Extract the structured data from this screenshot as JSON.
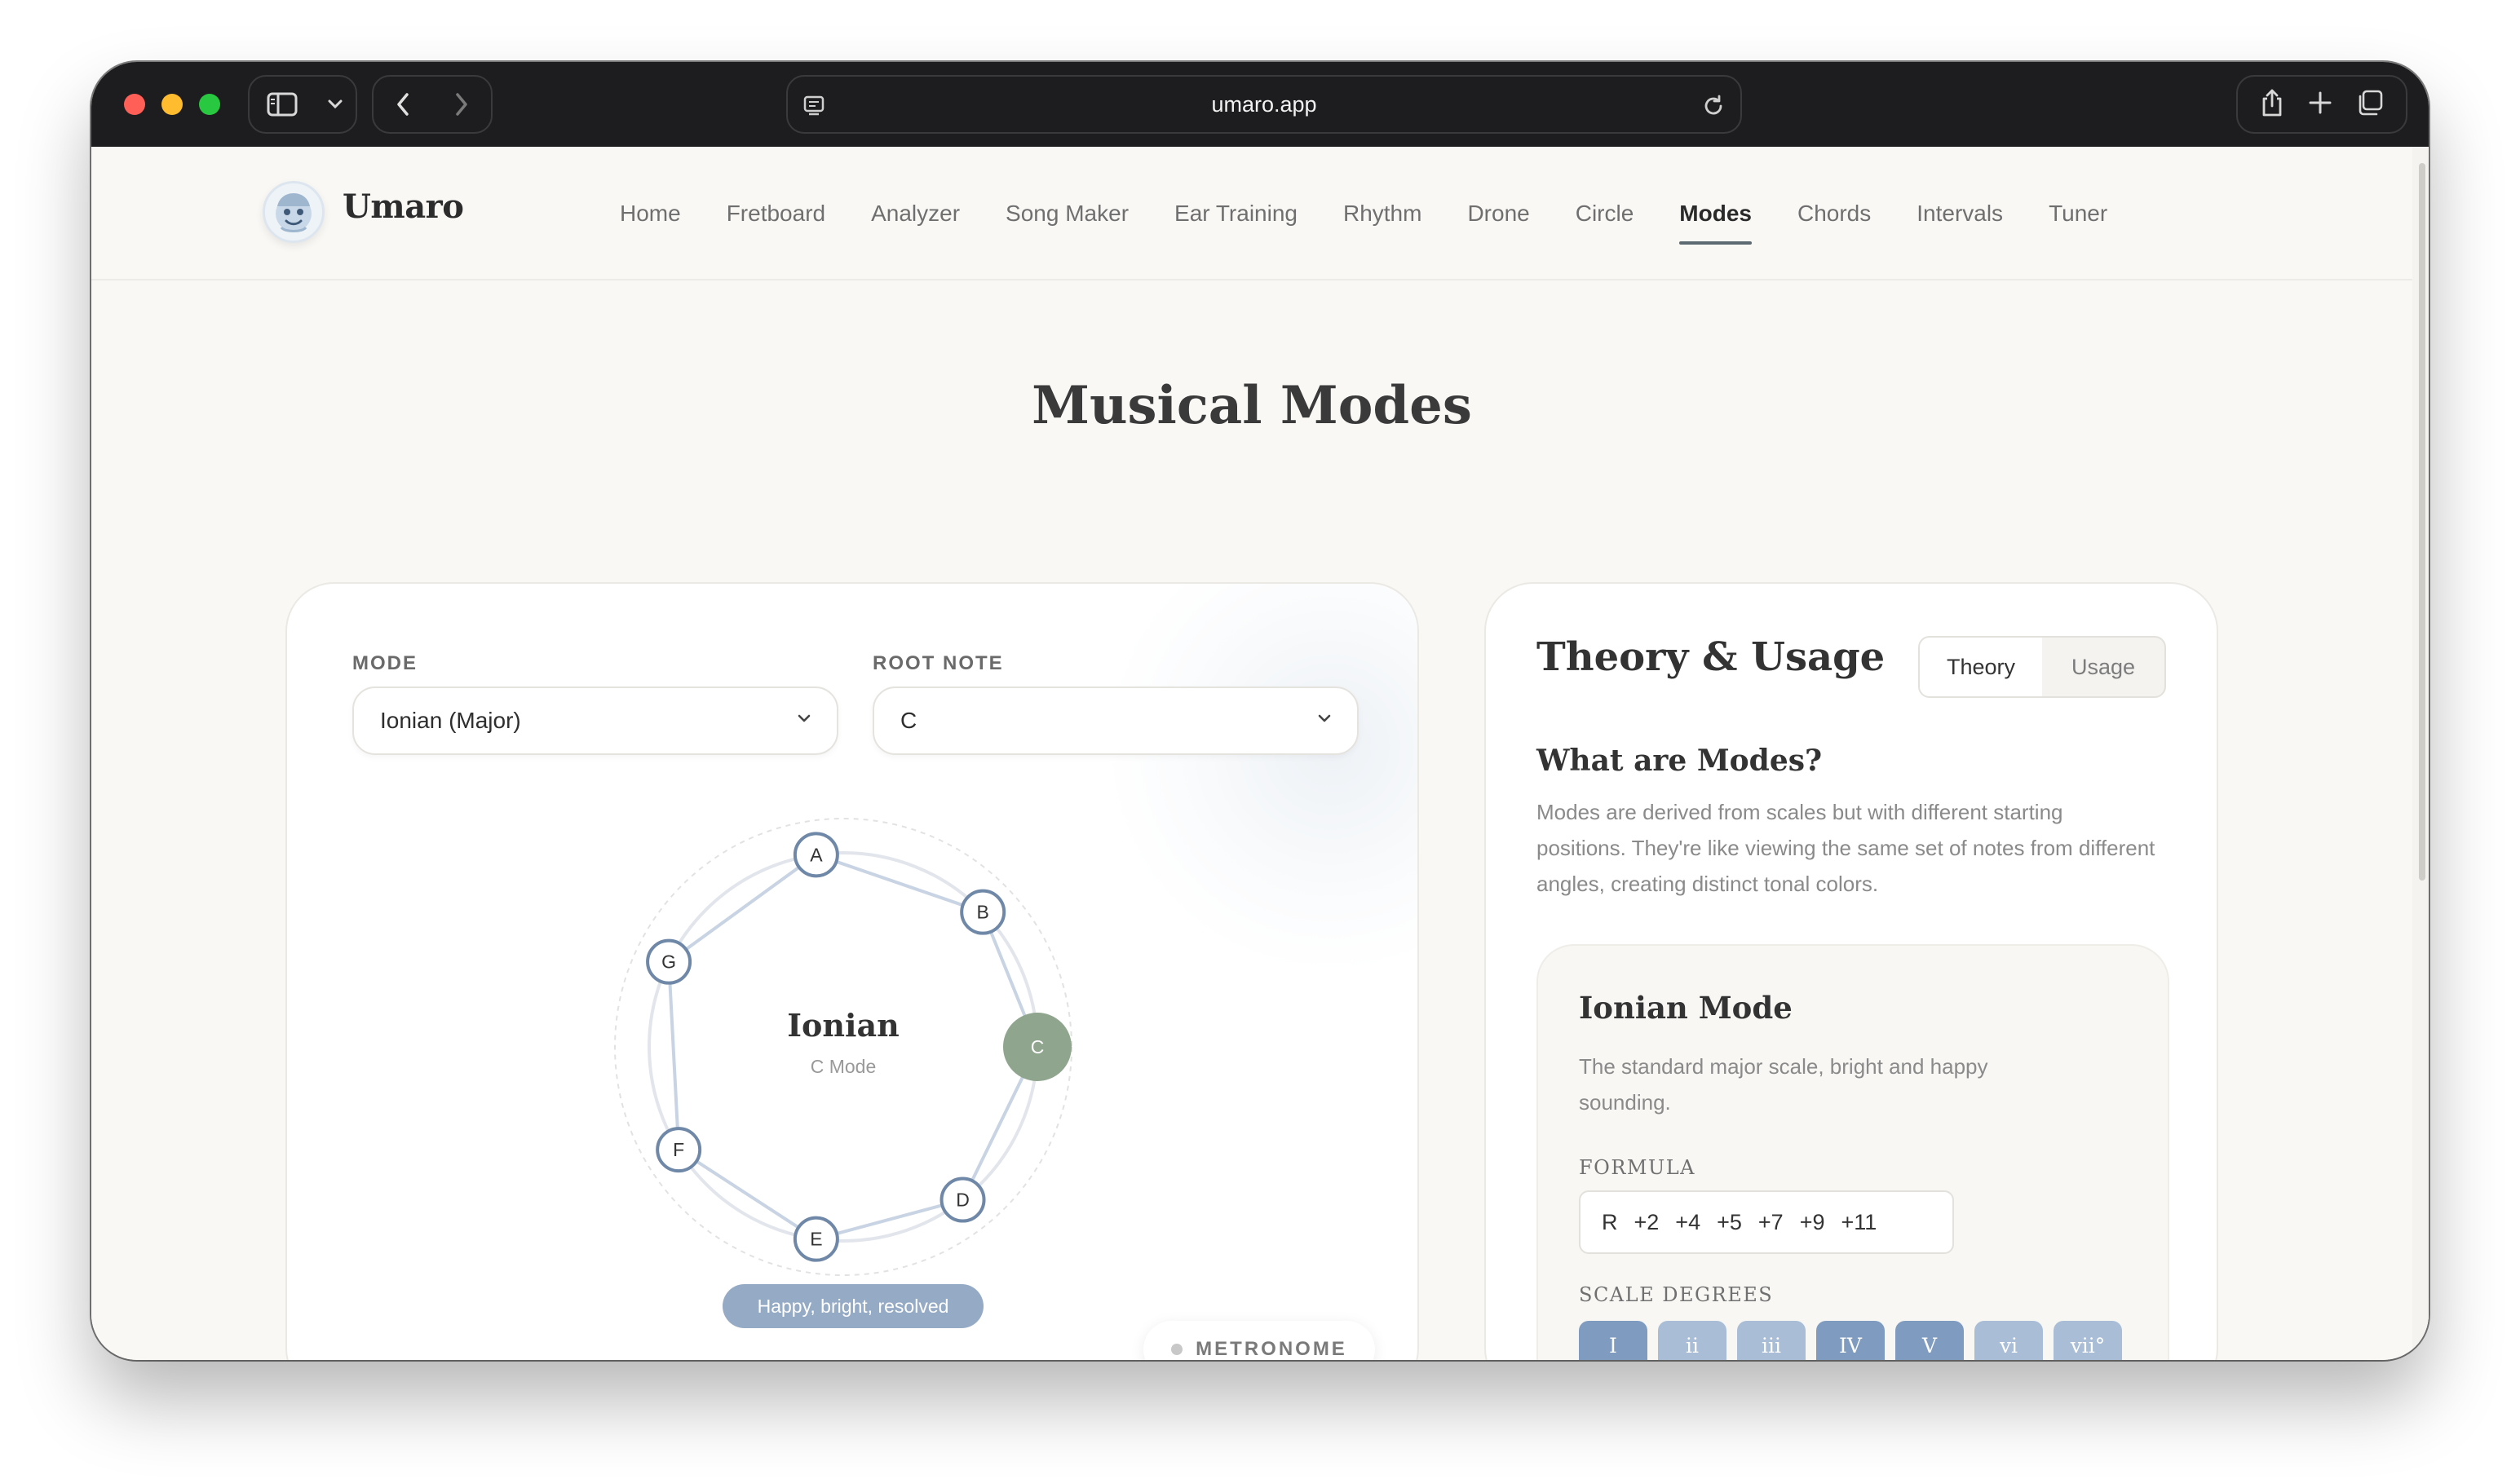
{
  "browser": {
    "url": "umaro.app"
  },
  "site": {
    "logo_text": "Umaro",
    "nav": [
      "Home",
      "Fretboard",
      "Analyzer",
      "Song Maker",
      "Ear Training",
      "Rhythm",
      "Drone",
      "Circle",
      "Modes",
      "Chords",
      "Intervals",
      "Tuner"
    ],
    "active_nav": "Modes"
  },
  "page": {
    "title": "Musical Modes"
  },
  "controls": {
    "mode_label": "MODE",
    "mode_value": "Ionian (Major)",
    "root_label": "ROOT NOTE",
    "root_value": "C"
  },
  "wheel": {
    "center_title": "Ionian",
    "center_subtitle": "C Mode",
    "notes": [
      "A",
      "B",
      "C",
      "D",
      "E",
      "F",
      "G"
    ],
    "root_note": "C",
    "mood": "Happy, bright, resolved",
    "root_color": "#8fa58e",
    "node_stroke": "#6f88a8"
  },
  "metronome": {
    "label": "METRONOME"
  },
  "theory": {
    "panel_title": "Theory & Usage",
    "tabs": [
      "Theory",
      "Usage"
    ],
    "active_tab": "Theory",
    "section_title": "What are Modes?",
    "section_text": "Modes are derived from scales but with different starting positions. They're like viewing the same set of notes from different angles, creating distinct tonal colors.",
    "mode_title": "Ionian Mode",
    "mode_text": "The standard major scale, bright and happy sounding.",
    "formula_label": "FORMULA",
    "formula": [
      "R",
      "+2",
      "+4",
      "+5",
      "+7",
      "+9",
      "+11"
    ],
    "degrees_label": "SCALE DEGREES",
    "degrees": [
      {
        "label": "I",
        "color": "#7f9cc0"
      },
      {
        "label": "ii",
        "color": "#a9bdd6"
      },
      {
        "label": "iii",
        "color": "#a9bdd6"
      },
      {
        "label": "IV",
        "color": "#7f9cc0"
      },
      {
        "label": "V",
        "color": "#7f9cc0"
      },
      {
        "label": "vi",
        "color": "#a9bdd6"
      },
      {
        "label": "vii°",
        "color": "#a9bdd6"
      }
    ]
  }
}
